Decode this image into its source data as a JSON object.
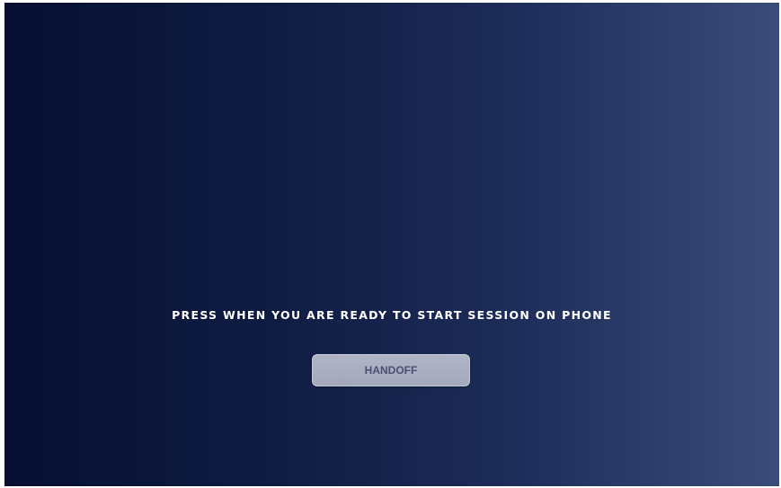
{
  "screen": {
    "prompt_text": "PRESS WHEN YOU ARE READY TO START SESSION ON PHONE",
    "handoff_label": "HANDOFF"
  },
  "colors": {
    "gradient_left": "#070f33",
    "gradient_right": "#3a4c78",
    "button_bg": "#a9adc1",
    "button_text": "#4a4f73",
    "prompt_text": "#ffffff"
  }
}
